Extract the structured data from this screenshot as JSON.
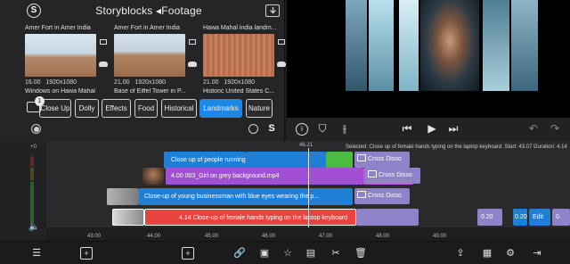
{
  "media": {
    "title": "Storyblocks ◂Footage",
    "thumbs": [
      {
        "title": "Amer Fort in Amer India",
        "duration": "16.00",
        "resolution": "1920x1080"
      },
      {
        "title": "Amer Fort in Amer India",
        "duration": "21.00",
        "resolution": "1920x1080"
      },
      {
        "title": "Hawa Mahal india landm...",
        "duration": "21.00",
        "resolution": "1920x1080"
      }
    ],
    "row2_titles": [
      "Windows on Hawa Mahal",
      "Base of Eiffel Tower in P...",
      "Historic United States C..."
    ],
    "badge_count": "1",
    "categories": [
      "Close Up",
      "Dolly",
      "Effects",
      "Food",
      "Historical",
      "Landmarks",
      "Nature"
    ],
    "active_category": "Landmarks",
    "sb_logo": "S"
  },
  "preview": {
    "strip_colors": [
      "#3d6f86",
      "#a9d7e7",
      "#5a5c5e",
      "#9ec9d6",
      "#2f6d8e",
      "#6fa9c0"
    ]
  },
  "controls": {
    "info_icon": "info-icon",
    "marker_icon": "marker-icon",
    "split_icon": "split-icon",
    "skip_back": "skip-back-icon",
    "play": "play-icon",
    "skip_fwd": "skip-forward-icon",
    "undo": "undo-icon",
    "redo": "redo-icon"
  },
  "timeline": {
    "zero": "+0",
    "playhead_time": "46.21",
    "selection_info": "Selected: Close up of female hands typing on the laptop keyboard. Start: 43.07 Duration: 4.14",
    "clips": [
      {
        "label": "Close up of people running ...",
        "color": "#1f7fd6"
      },
      {
        "label": "4.00   003_Girl on grey background.mp4",
        "color": "#a14fd4"
      },
      {
        "label": "Close-up of young businessman with blue eyes wearing the p...",
        "color": "#1f7fd6"
      },
      {
        "label": "4.14   Close-up of female hands typing on the laptop keyboard",
        "color": "#e7443f"
      }
    ],
    "transitions": [
      "Cross Disso",
      "Cross Disso",
      "Cross Disso"
    ],
    "right_clips": [
      "0.20",
      "0.20",
      "Edit",
      "0."
    ],
    "ruler_labels": [
      "43.00",
      "44.00",
      "45.00",
      "46.00",
      "47.00",
      "48.00",
      "49.00"
    ]
  },
  "toolbar": {
    "icons": [
      "list-icon",
      "add-icon",
      "add-clip-icon",
      "link-icon",
      "image-icon",
      "star-icon",
      "title-icon",
      "scissors-icon",
      "trash-icon",
      "share-icon",
      "layers-icon",
      "settings-icon",
      "export-icon"
    ]
  }
}
